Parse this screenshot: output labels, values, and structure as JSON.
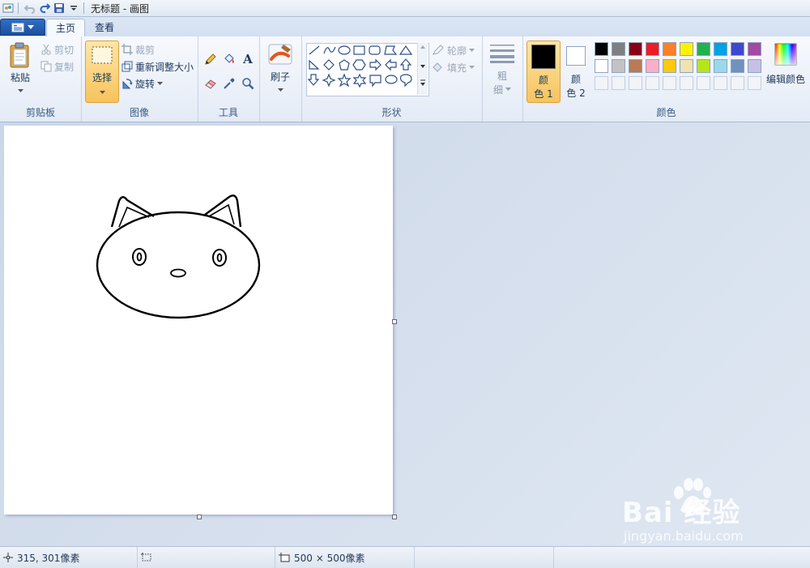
{
  "window": {
    "title": "无标题 - 画图"
  },
  "tabs": [
    {
      "label": "主页"
    },
    {
      "label": "查看"
    }
  ],
  "clipboard": {
    "group_label": "剪贴板",
    "paste": "粘贴",
    "cut": "剪切",
    "copy": "复制"
  },
  "image": {
    "group_label": "图像",
    "select": "选择",
    "crop": "裁剪",
    "resize": "重新调整大小",
    "rotate": "旋转"
  },
  "tools": {
    "group_label": "工具"
  },
  "brushes": {
    "label": "刷子"
  },
  "shapes": {
    "group_label": "形状",
    "outline": "轮廓",
    "fill": "填充"
  },
  "size": {
    "label_line1": "粗",
    "label_line2": "细"
  },
  "colors": {
    "group_label": "颜色",
    "color1_line1": "颜",
    "color1_line2": "色 1",
    "color2_line1": "颜",
    "color2_line2": "色 2",
    "edit": "编辑颜色",
    "color1_value": "#000000",
    "color2_value": "#ffffff",
    "palette_row1": [
      "#000000",
      "#7f7f7f",
      "#880015",
      "#ed1c24",
      "#ff7f27",
      "#fff200",
      "#22b14c",
      "#00a2e8",
      "#3f48cc",
      "#a349a4"
    ],
    "palette_row2": [
      "#ffffff",
      "#c3c3c3",
      "#b97a57",
      "#ffaec9",
      "#ffc90e",
      "#efe4b0",
      "#b5e61d",
      "#99d9ea",
      "#7092be",
      "#c8bfe7"
    ]
  },
  "status": {
    "cursor_position": "315, 301像素",
    "canvas_size": "500 × 500像素"
  },
  "watermark": {
    "logo": "Bai  经验",
    "url": "jingyan.baidu.com"
  }
}
